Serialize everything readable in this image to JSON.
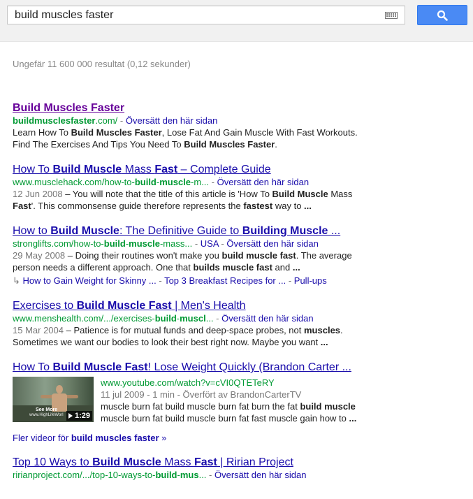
{
  "search": {
    "query": "build muscles faster",
    "button_label": "search-icon"
  },
  "stats": "Ungefär 11 600 000 resultat (0,12 sekunder)",
  "results": [
    {
      "title_parts": [
        {
          "t": "Build Muscles Faster",
          "b": false
        }
      ],
      "cite": [
        {
          "t": "buildmusclesfaster",
          "b": true
        },
        {
          "t": ".com/",
          "b": false
        }
      ],
      "translate": "Översätt den här sidan",
      "snippet": [
        {
          "t": "Learn How To ",
          "b": false
        },
        {
          "t": "Build Muscles Faster",
          "b": true
        },
        {
          "t": ", Lose Fat And Gain Muscle With Fast Workouts. Find The Exercises And Tips You Need To ",
          "b": false
        },
        {
          "t": "Build Muscles Faster",
          "b": true
        },
        {
          "t": ".",
          "b": false
        }
      ]
    },
    {
      "title_parts": [
        {
          "t": "How To ",
          "b": false
        },
        {
          "t": "Build Muscle",
          "b": true
        },
        {
          "t": " Mass ",
          "b": false
        },
        {
          "t": "Fast",
          "b": true
        },
        {
          "t": " – Complete Guide",
          "b": false
        }
      ],
      "cite": [
        {
          "t": "www.musclehack.com/how-to-",
          "b": false
        },
        {
          "t": "build",
          "b": true
        },
        {
          "t": "-",
          "b": false
        },
        {
          "t": "muscle",
          "b": true
        },
        {
          "t": "-m...",
          "b": false
        }
      ],
      "translate": "Översätt den här sidan",
      "date": "12 Jun 2008",
      "snippet": [
        {
          "t": " – You will note that the title of this article is 'How To ",
          "b": false
        },
        {
          "t": "Build Muscle",
          "b": true
        },
        {
          "t": " Mass ",
          "b": false
        },
        {
          "t": "Fast",
          "b": true
        },
        {
          "t": "'. This commonsense guide therefore represents the ",
          "b": false
        },
        {
          "t": "fastest",
          "b": true
        },
        {
          "t": " way to ",
          "b": false
        },
        {
          "t": "...",
          "b": true
        }
      ]
    },
    {
      "title_parts": [
        {
          "t": "How to ",
          "b": false
        },
        {
          "t": "Build Muscle",
          "b": true
        },
        {
          "t": ": The Definitive Guide to ",
          "b": false
        },
        {
          "t": "Building Muscle",
          "b": true
        },
        {
          "t": " ...",
          "b": false
        }
      ],
      "cite": [
        {
          "t": "stronglifts.com/how-to-",
          "b": false
        },
        {
          "t": "build",
          "b": true
        },
        {
          "t": "-",
          "b": false
        },
        {
          "t": "muscle",
          "b": true
        },
        {
          "t": "-mass...",
          "b": false
        }
      ],
      "extra": "USA",
      "translate": "Översätt den här sidan",
      "date": "29 May 2008",
      "snippet": [
        {
          "t": " – Doing their routines won't make you ",
          "b": false
        },
        {
          "t": "build muscle fast",
          "b": true
        },
        {
          "t": ". The average person needs a different approach. One that ",
          "b": false
        },
        {
          "t": "builds muscle fast",
          "b": true
        },
        {
          "t": " and ",
          "b": false
        },
        {
          "t": "...",
          "b": true
        }
      ],
      "sitelinks": [
        "How to Gain Weight for Skinny ...",
        "Top 3 Breakfast Recipes for ...",
        "Pull-ups"
      ]
    },
    {
      "title_parts": [
        {
          "t": "Exercises to ",
          "b": false
        },
        {
          "t": "Build Muscle Fast",
          "b": true
        },
        {
          "t": " | Men's Health",
          "b": false
        }
      ],
      "cite": [
        {
          "t": "www.menshealth.com/.../exercises-",
          "b": false
        },
        {
          "t": "build",
          "b": true
        },
        {
          "t": "-",
          "b": false
        },
        {
          "t": "muscl",
          "b": true
        },
        {
          "t": "...",
          "b": false
        }
      ],
      "translate": "Översätt den här sidan",
      "date": "15 Mar 2004",
      "snippet": [
        {
          "t": " – Patience is for mutual funds and deep-space probes, not ",
          "b": false
        },
        {
          "t": "muscles",
          "b": true
        },
        {
          "t": ". Sometimes we want our bodies to look their best right now. Maybe you want ",
          "b": false
        },
        {
          "t": "...",
          "b": true
        }
      ]
    }
  ],
  "video": {
    "title_parts": [
      {
        "t": "How To ",
        "b": false
      },
      {
        "t": "Build Muscle Fast",
        "b": true
      },
      {
        "t": "! Lose Weight Quickly (Brandon Carter ...",
        "b": false
      }
    ],
    "cite": "www.youtube.com/watch?v=cVI0QTETeRY",
    "meta": "11 jul 2009 - 1 min - Överfört av BrandonCarterTV",
    "snippet": [
      {
        "t": "muscle burn fat build muscle burn fat burn the fat ",
        "b": false
      },
      {
        "t": "build muscle",
        "b": true
      },
      {
        "t": " muscle burn fat build muscle burn fat fast muscle gain how to ",
        "b": false
      },
      {
        "t": "...",
        "b": true
      }
    ],
    "thumb_see_more": "See More",
    "thumb_url": "www.HighLifeWorl",
    "duration": "1:29"
  },
  "more_videos": {
    "prefix": "Fler videor för ",
    "query": "build muscles faster",
    "suffix": " »"
  },
  "last_result": {
    "title_parts": [
      {
        "t": "Top 10 Ways to ",
        "b": false
      },
      {
        "t": "Build Muscle",
        "b": true
      },
      {
        "t": " Mass ",
        "b": false
      },
      {
        "t": "Fast",
        "b": true
      },
      {
        "t": " | Ririan Project",
        "b": false
      }
    ],
    "cite": [
      {
        "t": "ririanproject.com/.../top-10-ways-to-",
        "b": false
      },
      {
        "t": "build",
        "b": true
      },
      {
        "t": "-",
        "b": false
      },
      {
        "t": "mus",
        "b": true
      },
      {
        "t": "...",
        "b": false
      }
    ],
    "translate": "Översätt den här sidan"
  },
  "colors": {
    "link": "#1a0dab",
    "visited": "#660099",
    "cite": "#009933",
    "button": "#4a8af4"
  }
}
